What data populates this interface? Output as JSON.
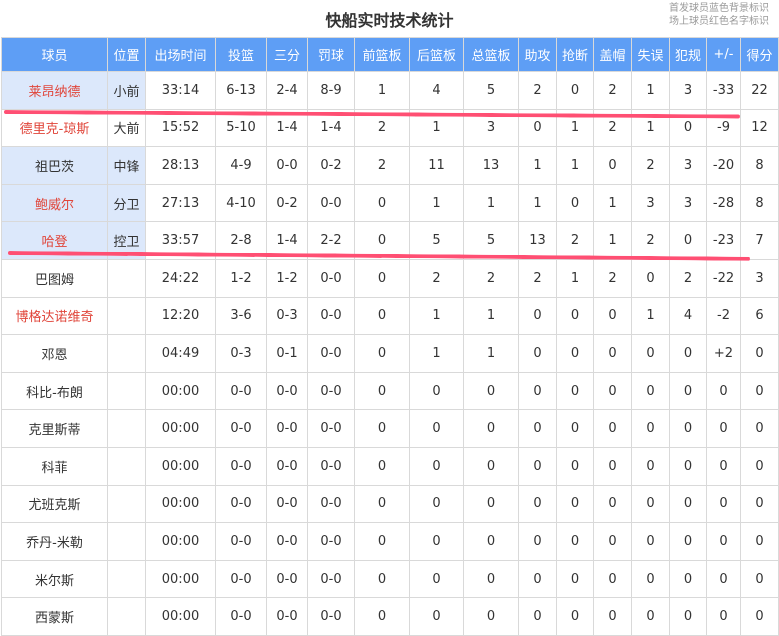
{
  "title": "快船实时技术统计",
  "legend": [
    "首发球员蓝色背景标识",
    "场上球员红色名字标识"
  ],
  "colors": {
    "header": "#5e9ef5",
    "starter_bg": "#dce8fb",
    "oncourt_name": "#e0453a",
    "annotation_line": "#ff4f73"
  },
  "columns": [
    "球员",
    "位置",
    "出场时间",
    "投篮",
    "三分",
    "罚球",
    "前篮板",
    "后篮板",
    "总篮板",
    "助攻",
    "抢断",
    "盖帽",
    "失误",
    "犯规",
    "+/-",
    "得分"
  ],
  "rows": [
    {
      "starter": true,
      "oncourt": true,
      "cells": [
        "莱昂纳德",
        "小前",
        "33:14",
        "6-13",
        "2-4",
        "8-9",
        "1",
        "4",
        "5",
        "2",
        "0",
        "2",
        "1",
        "3",
        "-33",
        "22"
      ]
    },
    {
      "starter": false,
      "oncourt": true,
      "cells": [
        "德里克-琼斯",
        "大前",
        "15:52",
        "5-10",
        "1-4",
        "1-4",
        "2",
        "1",
        "3",
        "0",
        "1",
        "2",
        "1",
        "0",
        "-9",
        "12"
      ]
    },
    {
      "starter": true,
      "oncourt": false,
      "cells": [
        "祖巴茨",
        "中锋",
        "28:13",
        "4-9",
        "0-0",
        "0-2",
        "2",
        "11",
        "13",
        "1",
        "1",
        "0",
        "2",
        "3",
        "-20",
        "8"
      ]
    },
    {
      "starter": true,
      "oncourt": true,
      "cells": [
        "鲍威尔",
        "分卫",
        "27:13",
        "4-10",
        "0-2",
        "0-0",
        "0",
        "1",
        "1",
        "1",
        "0",
        "1",
        "3",
        "3",
        "-28",
        "8"
      ]
    },
    {
      "starter": true,
      "oncourt": true,
      "cells": [
        "哈登",
        "控卫",
        "33:57",
        "2-8",
        "1-4",
        "2-2",
        "0",
        "5",
        "5",
        "13",
        "2",
        "1",
        "2",
        "0",
        "-23",
        "7"
      ]
    },
    {
      "starter": false,
      "oncourt": false,
      "cells": [
        "巴图姆",
        "",
        "24:22",
        "1-2",
        "1-2",
        "0-0",
        "0",
        "2",
        "2",
        "2",
        "1",
        "2",
        "0",
        "2",
        "-22",
        "3"
      ]
    },
    {
      "starter": false,
      "oncourt": true,
      "cells": [
        "博格达诺维奇",
        "",
        "12:20",
        "3-6",
        "0-3",
        "0-0",
        "0",
        "1",
        "1",
        "0",
        "0",
        "0",
        "1",
        "4",
        "-2",
        "6"
      ]
    },
    {
      "starter": false,
      "oncourt": false,
      "cells": [
        "邓恩",
        "",
        "04:49",
        "0-3",
        "0-1",
        "0-0",
        "0",
        "1",
        "1",
        "0",
        "0",
        "0",
        "0",
        "0",
        "+2",
        "0"
      ]
    },
    {
      "starter": false,
      "oncourt": false,
      "cells": [
        "科比-布朗",
        "",
        "00:00",
        "0-0",
        "0-0",
        "0-0",
        "0",
        "0",
        "0",
        "0",
        "0",
        "0",
        "0",
        "0",
        "0",
        "0"
      ]
    },
    {
      "starter": false,
      "oncourt": false,
      "cells": [
        "克里斯蒂",
        "",
        "00:00",
        "0-0",
        "0-0",
        "0-0",
        "0",
        "0",
        "0",
        "0",
        "0",
        "0",
        "0",
        "0",
        "0",
        "0"
      ]
    },
    {
      "starter": false,
      "oncourt": false,
      "cells": [
        "科菲",
        "",
        "00:00",
        "0-0",
        "0-0",
        "0-0",
        "0",
        "0",
        "0",
        "0",
        "0",
        "0",
        "0",
        "0",
        "0",
        "0"
      ]
    },
    {
      "starter": false,
      "oncourt": false,
      "cells": [
        "尤班克斯",
        "",
        "00:00",
        "0-0",
        "0-0",
        "0-0",
        "0",
        "0",
        "0",
        "0",
        "0",
        "0",
        "0",
        "0",
        "0",
        "0"
      ]
    },
    {
      "starter": false,
      "oncourt": false,
      "cells": [
        "乔丹-米勒",
        "",
        "00:00",
        "0-0",
        "0-0",
        "0-0",
        "0",
        "0",
        "0",
        "0",
        "0",
        "0",
        "0",
        "0",
        "0",
        "0"
      ]
    },
    {
      "starter": false,
      "oncourt": false,
      "cells": [
        "米尔斯",
        "",
        "00:00",
        "0-0",
        "0-0",
        "0-0",
        "0",
        "0",
        "0",
        "0",
        "0",
        "0",
        "0",
        "0",
        "0",
        "0"
      ]
    },
    {
      "starter": false,
      "oncourt": false,
      "cells": [
        "西蒙斯",
        "",
        "00:00",
        "0-0",
        "0-0",
        "0-0",
        "0",
        "0",
        "0",
        "0",
        "0",
        "0",
        "0",
        "0",
        "0",
        "0"
      ]
    }
  ]
}
